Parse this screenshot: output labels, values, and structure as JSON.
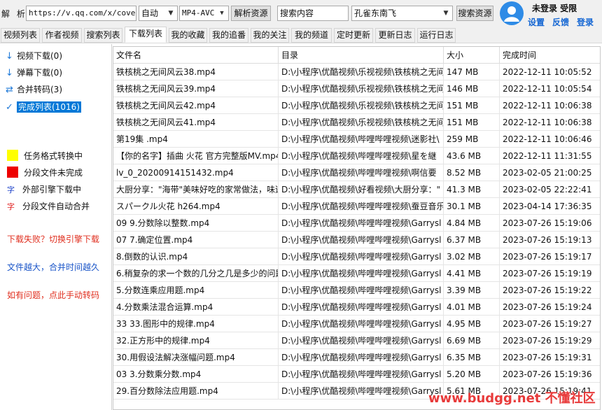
{
  "topbar": {
    "parse_label": "解 析:",
    "url_value": "https://v.qq.com/x/cover/",
    "mode": "自动",
    "format": "MP4-AVC",
    "parse_button": "解析资源",
    "search_placeholder": "搜索内容",
    "source": "孔雀东南飞",
    "search_button": "搜索资源"
  },
  "user": {
    "status": "未登录 受限",
    "settings": "设置",
    "feedback": "反馈",
    "login": "登录"
  },
  "tabs": [
    "视频列表",
    "作者视频",
    "搜索列表",
    "下载列表",
    "我的收藏",
    "我的追番",
    "我的关注",
    "我的频道",
    "定时更新",
    "更新日志",
    "运行日志"
  ],
  "active_tab": "下载列表",
  "sidebar": {
    "items": [
      {
        "icon": "down-arrow-icon",
        "glyph": "↓",
        "label": "视频下载(0)"
      },
      {
        "icon": "down-arrow-icon",
        "glyph": "↓",
        "label": "弹幕下载(0)"
      },
      {
        "icon": "merge-icon",
        "glyph": "⇄",
        "label": "合并转码(3)"
      },
      {
        "icon": "check-icon",
        "glyph": "✓",
        "label": "完成列表(1016)"
      }
    ],
    "legend": [
      {
        "color": "#ffff00",
        "label": "任务格式转换中"
      },
      {
        "color": "#ee0000",
        "label": "分段文件未完成"
      }
    ],
    "legend_zi": [
      {
        "glyph": "字",
        "color": "#1a3fc8",
        "label": "外部引擎下载中"
      },
      {
        "glyph": "字",
        "color": "#e02020",
        "label": "分段文件自动合并"
      }
    ],
    "notes": [
      {
        "text": "下载失败？切换引擎下载",
        "color": "red"
      },
      {
        "text": "文件越大，合并时间越久",
        "color": "blue"
      },
      {
        "text": "如有问题，点此手动转码",
        "color": "red"
      }
    ]
  },
  "table": {
    "headers": [
      "文件名",
      "目录",
      "大小",
      "完成时间"
    ],
    "rows": [
      [
        "铁核桃之无间风云38.mp4",
        "D:\\小程序\\优酷视频\\乐视视频\\铁核桃之无间",
        "147 MB",
        "2022-12-11 10:05:52"
      ],
      [
        "铁核桃之无间风云39.mp4",
        "D:\\小程序\\优酷视频\\乐视视频\\铁核桃之无间",
        "146 MB",
        "2022-12-11 10:05:54"
      ],
      [
        "铁核桃之无间风云42.mp4",
        "D:\\小程序\\优酷视频\\乐视视频\\铁核桃之无间",
        "151 MB",
        "2022-12-11 10:06:38"
      ],
      [
        "铁核桃之无间风云41.mp4",
        "D:\\小程序\\优酷视频\\乐视视频\\铁核桃之无间",
        "151 MB",
        "2022-12-11 10:06:38"
      ],
      [
        "第19集 .mp4",
        "D:\\小程序\\优酷视频\\哔哩哔哩视频\\迷影社\\",
        "259 MB",
        "2022-12-11 10:06:46"
      ],
      [
        "【你的名字】插曲 火花 官方完整版MV.mp4",
        "D:\\小程序\\优酷视频\\哔哩哔哩视频\\星を継",
        "43.6 MB",
        "2022-12-11 11:31:55"
      ],
      [
        "lv_0_20200914151432.mp4",
        "D:\\小程序\\优酷视频\\哔哩哔哩视频\\啊信要",
        "8.52 MB",
        "2023-02-05 21:00:25"
      ],
      [
        "大厨分享：\"海带\"美味好吃的家常做法，味道",
        "D:\\小程序\\优酷视频\\好看视频\\大厨分享：\"",
        "41.3 MB",
        "2023-02-05 22:22:41"
      ],
      [
        "スパークル火花 h264.mp4",
        "D:\\小程序\\优酷视频\\哔哩哔哩视频\\蚕豆音乐",
        "30.1 MB",
        "2023-04-14 17:36:35"
      ],
      [
        "09 9.分数除以整数.mp4",
        "D:\\小程序\\优酷视频\\哔哩哔哩视频\\Garrysl",
        "4.84 MB",
        "2023-07-26 15:19:06"
      ],
      [
        "07 7.确定位置.mp4",
        "D:\\小程序\\优酷视频\\哔哩哔哩视频\\Garrysl",
        "6.37 MB",
        "2023-07-26 15:19:13"
      ],
      [
        "8.倒数的认识.mp4",
        "D:\\小程序\\优酷视频\\哔哩哔哩视频\\Garrysl",
        "3.02 MB",
        "2023-07-26 15:19:17"
      ],
      [
        "6.稍复杂的求一个数的几分之几是多少的问题",
        "D:\\小程序\\优酷视频\\哔哩哔哩视频\\Garrysl",
        "4.41 MB",
        "2023-07-26 15:19:19"
      ],
      [
        "5.分数连乘应用题.mp4",
        "D:\\小程序\\优酷视频\\哔哩哔哩视频\\Garrysl",
        "3.39 MB",
        "2023-07-26 15:19:22"
      ],
      [
        "4.分数乘法混合运算.mp4",
        "D:\\小程序\\优酷视频\\哔哩哔哩视频\\Garrysl",
        "4.01 MB",
        "2023-07-26 15:19:24"
      ],
      [
        "33 33.图形中的规律.mp4",
        "D:\\小程序\\优酷视频\\哔哩哔哩视频\\Garrysl",
        "4.95 MB",
        "2023-07-26 15:19:27"
      ],
      [
        "32.正方形中的规律.mp4",
        "D:\\小程序\\优酷视频\\哔哩哔哩视频\\Garrysl",
        "6.69 MB",
        "2023-07-26 15:19:29"
      ],
      [
        "30.用假设法解决涨幅问题.mp4",
        "D:\\小程序\\优酷视频\\哔哩哔哩视频\\Garrysl",
        "6.35 MB",
        "2023-07-26 15:19:31"
      ],
      [
        "03 3.分数乘分数.mp4",
        "D:\\小程序\\优酷视频\\哔哩哔哩视频\\Garrysl",
        "5.20 MB",
        "2023-07-26 15:19:36"
      ],
      [
        "29.百分数除法应用题.mp4",
        "D:\\小程序\\优酷视频\\哔哩哔哩视频\\Garrysl",
        "5.61 MB",
        "2023-07-26 15:19:41"
      ]
    ]
  },
  "watermark": "www.budgg.net 不懂社区"
}
